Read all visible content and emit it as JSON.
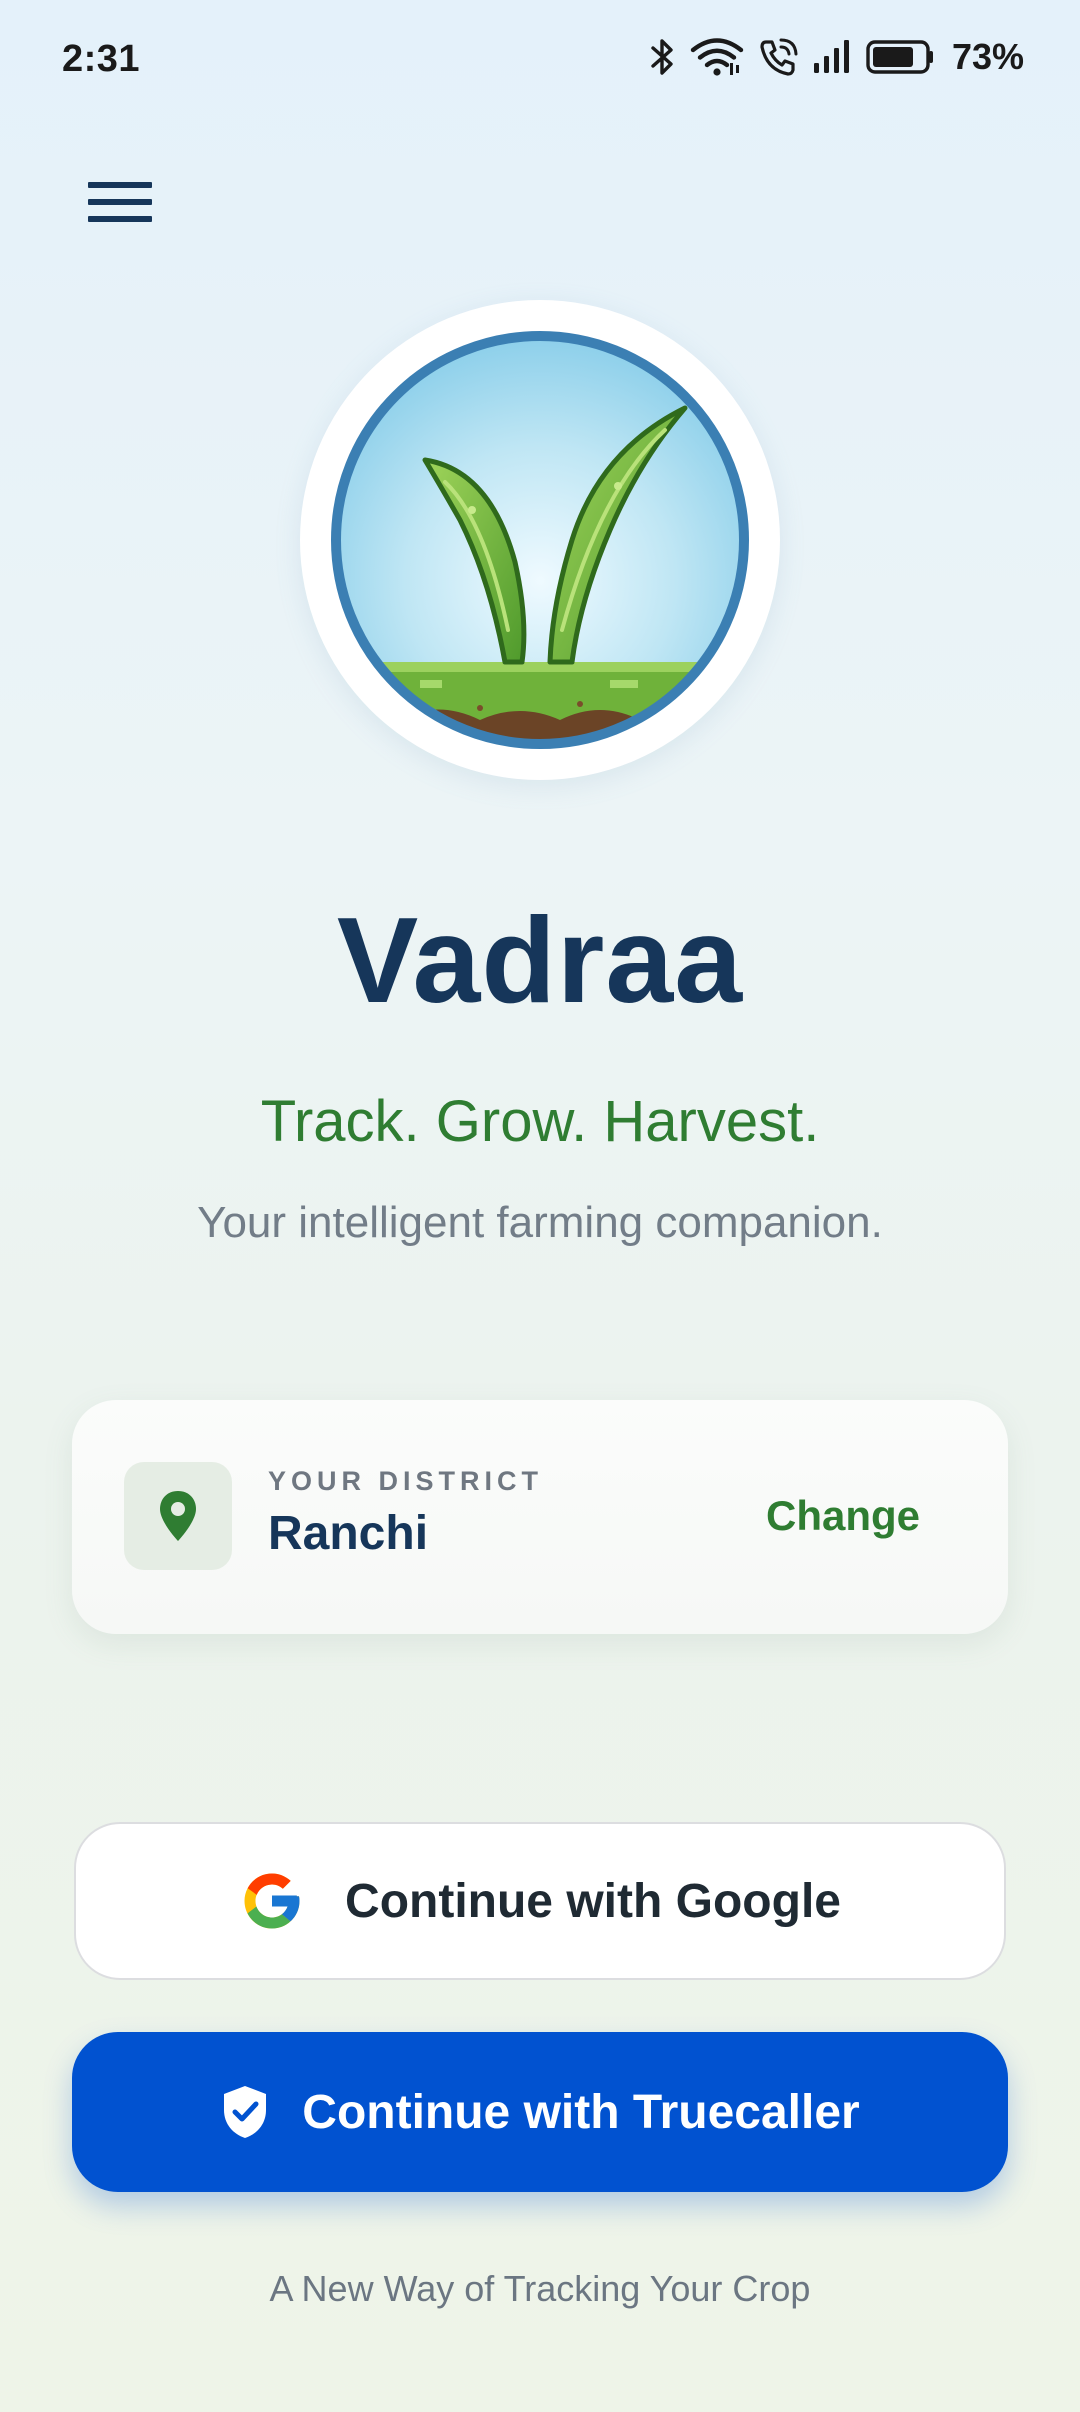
{
  "status_bar": {
    "time": "2:31",
    "battery_percent": "73%",
    "icons": [
      "bluetooth-icon",
      "wifi-icon",
      "wifi-call-icon",
      "signal-icon",
      "battery-icon"
    ]
  },
  "header": {
    "menu_icon": "hamburger-menu-icon"
  },
  "app": {
    "title": "Vadraa",
    "tagline": "Track. Grow. Harvest.",
    "subtitle": "Your intelligent farming companion.",
    "logo_icon": "sprout-logo-icon"
  },
  "district": {
    "label": "YOUR DISTRICT",
    "value": "Ranchi",
    "change_label": "Change",
    "icon": "location-pin-icon"
  },
  "auth": {
    "google_label": "Continue with Google",
    "google_icon": "google-g-icon",
    "truecaller_label": "Continue with Truecaller",
    "truecaller_icon": "shield-check-icon"
  },
  "footer": {
    "text": "A New Way of Tracking Your Crop"
  },
  "colors": {
    "title": "#16365a",
    "accent_green": "#2f7d32",
    "truecaller_blue": "#0152d0",
    "subtitle_gray": "#727d88"
  }
}
